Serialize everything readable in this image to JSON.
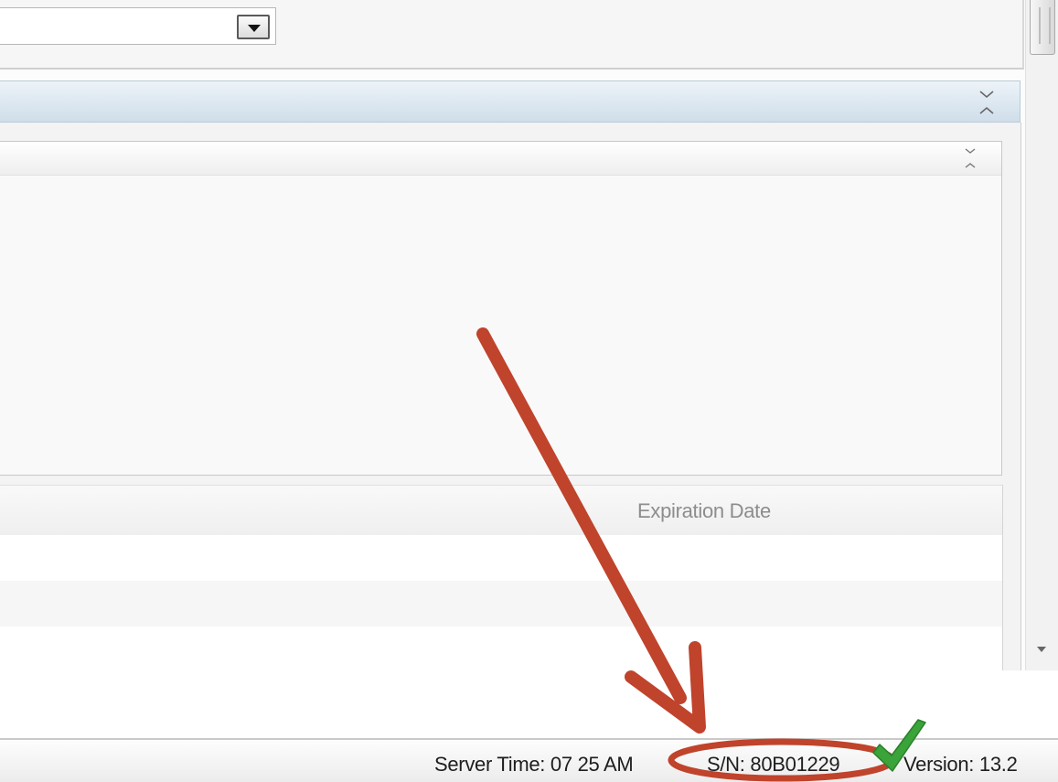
{
  "grid": {
    "columns": [
      "Expiration Date"
    ]
  },
  "status_bar": {
    "server_time": "Server Time: 07 25 AM",
    "serial": "S/N: 80B01229",
    "version": "Version: 13.2"
  },
  "icons": {
    "dropdown": "dropdown-arrow-icon",
    "panel_toggle": "collapse-expand-icon",
    "check": "green-checkmark-icon",
    "arrow": "red-arrow-annotation"
  },
  "colors": {
    "annotation": "#c0432c",
    "check": "#3aa33a",
    "panel_header": "#d6e3ee"
  }
}
